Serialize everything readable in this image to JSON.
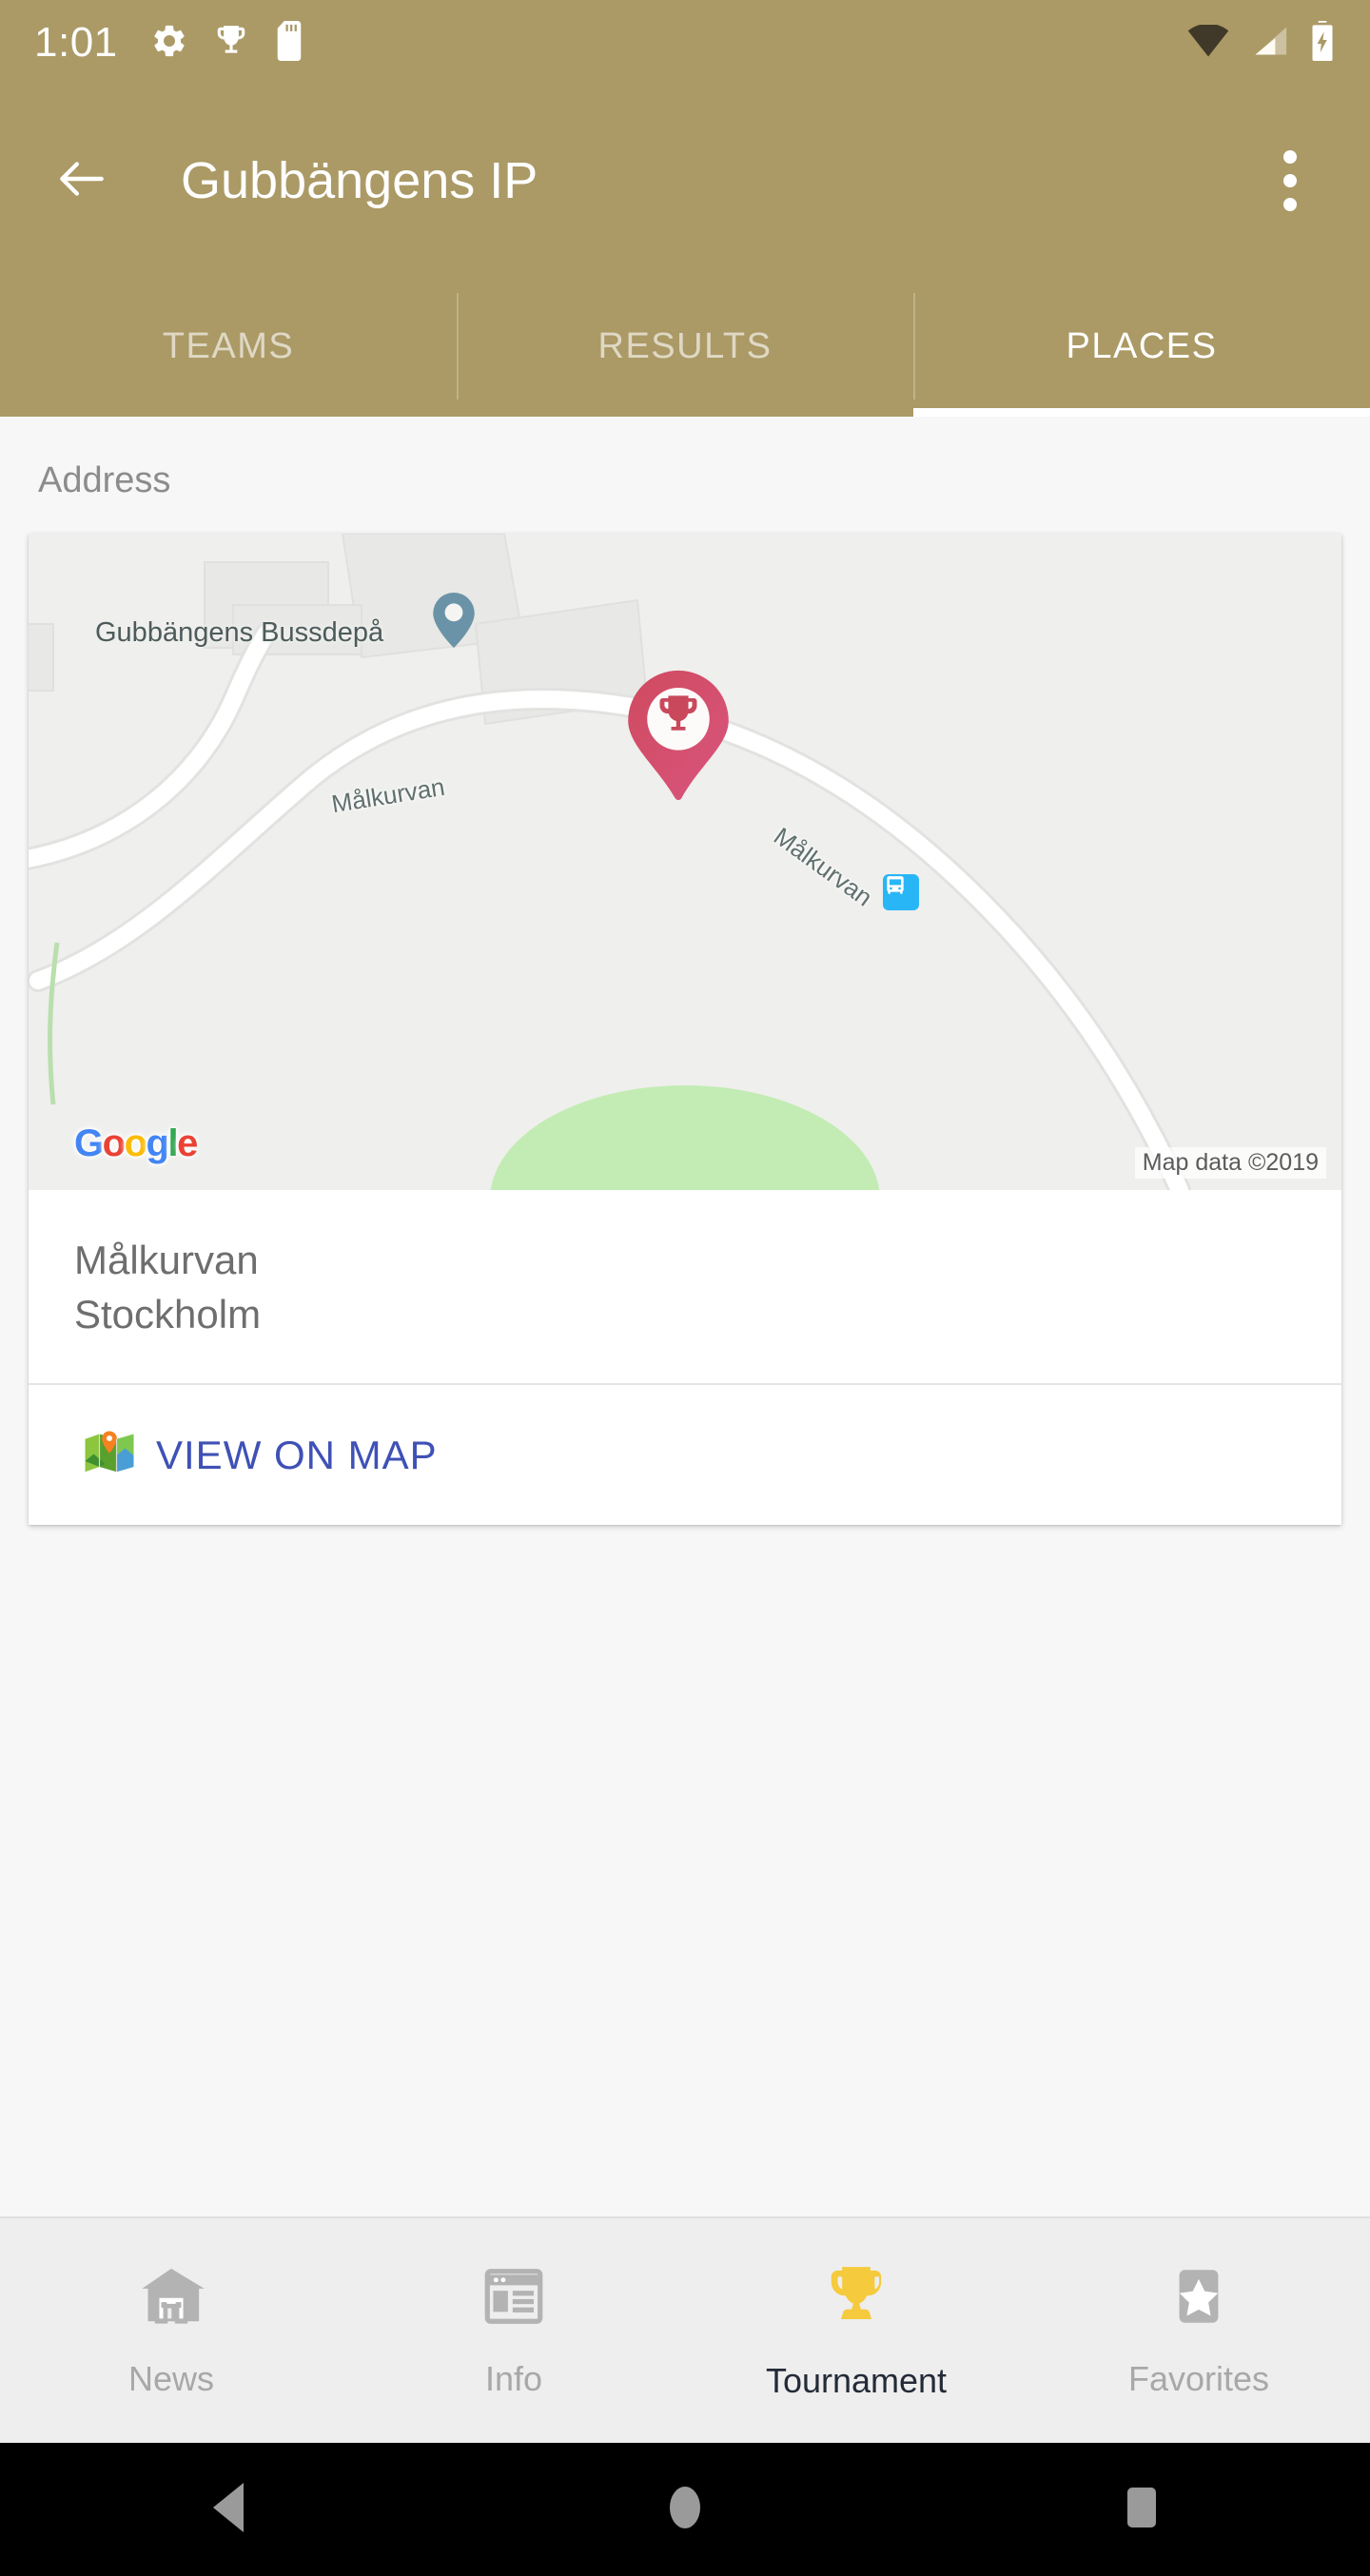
{
  "status_bar": {
    "time": "1:01",
    "left_icons": [
      "gear-icon",
      "trophy-icon",
      "sd-card-icon"
    ],
    "right_icons": [
      "wifi-icon",
      "cell-signal-icon",
      "battery-charging-icon"
    ]
  },
  "app_bar": {
    "back_icon": "arrow-back-icon",
    "title": "Gubbängens IP",
    "overflow_icon": "more-vert-icon",
    "background_color": "#ab9a66"
  },
  "tabs": {
    "items": [
      {
        "label": "TEAMS",
        "active": false
      },
      {
        "label": "RESULTS",
        "active": false
      },
      {
        "label": "PLACES",
        "active": true
      }
    ]
  },
  "content": {
    "section_label": "Address",
    "map": {
      "poi_label": "Gubbängens Bussdepå",
      "road_label_1": "Målkurvan",
      "road_label_2": "Målkurvan",
      "marker_icon": "trophy-map-marker",
      "poi_pin_icon": "place-pin-icon",
      "bus_stop_icon": "bus-stop-icon",
      "google_logo": {
        "g1": "G",
        "o1": "o",
        "o2": "o",
        "g2": "g",
        "l": "l",
        "e": "e"
      },
      "attribution": "Map data ©2019",
      "park_color": "#c2ecb4",
      "background_color": "#efefed"
    },
    "address": {
      "line1": "Målkurvan",
      "line2": "Stockholm"
    },
    "action": {
      "icon": "map-emoji-icon",
      "label": "VIEW ON MAP",
      "color": "#3f51b5"
    }
  },
  "bottom_nav": {
    "items": [
      {
        "label": "News",
        "icon": "home-icon",
        "active": false
      },
      {
        "label": "Info",
        "icon": "newspaper-icon",
        "active": false
      },
      {
        "label": "Tournament",
        "icon": "trophy-icon",
        "active": true
      },
      {
        "label": "Favorites",
        "icon": "star-icon",
        "active": false
      }
    ]
  },
  "android_nav": {
    "back": "back-triangle-icon",
    "home": "home-circle-icon",
    "recents": "recents-square-icon"
  }
}
